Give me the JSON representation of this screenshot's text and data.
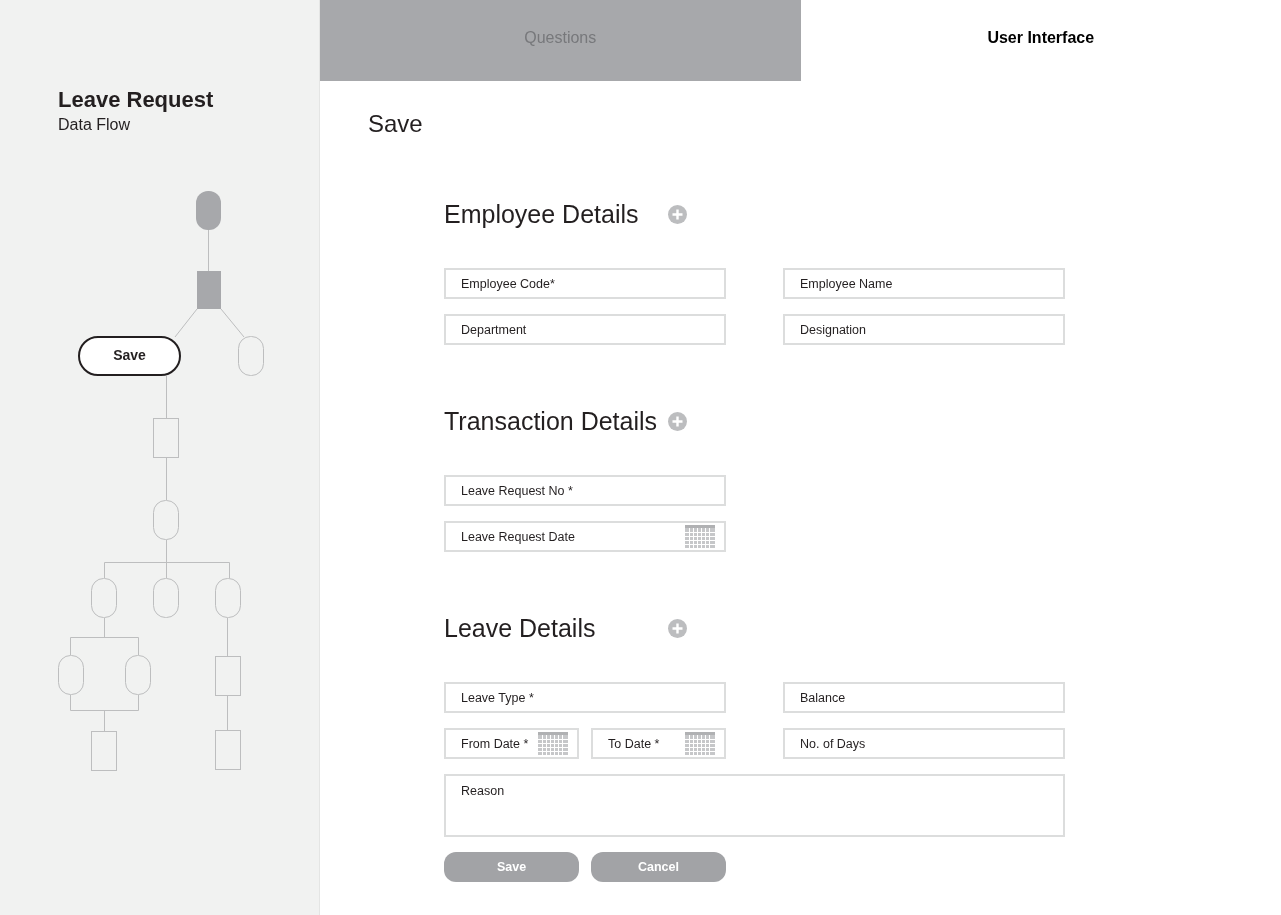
{
  "sidebar": {
    "title": "Leave Request",
    "subtitle": "Data Flow",
    "flow_node_label": "Save"
  },
  "tabs": [
    {
      "label": "Questions",
      "selected": false
    },
    {
      "label": "User Interface",
      "selected": true
    }
  ],
  "page_title": "Save",
  "sections": [
    {
      "title": "Employee Details",
      "rows": [
        {
          "left": [
            {
              "kind": "text",
              "placeholder": "Employee Code*"
            }
          ],
          "right": [
            {
              "kind": "text",
              "placeholder": "Employee Name"
            }
          ]
        },
        {
          "left": [
            {
              "kind": "text",
              "placeholder": "Department"
            }
          ],
          "right": [
            {
              "kind": "text",
              "placeholder": "Designation"
            }
          ]
        }
      ]
    },
    {
      "title": "Transaction Details",
      "rows": [
        {
          "left": [
            {
              "kind": "text",
              "placeholder": "Leave Request No *"
            }
          ]
        },
        {
          "left": [
            {
              "kind": "date",
              "placeholder": "Leave Request Date"
            }
          ]
        }
      ]
    },
    {
      "title": "Leave Details",
      "rows": [
        {
          "left": [
            {
              "kind": "text",
              "placeholder": "Leave Type *"
            }
          ],
          "right": [
            {
              "kind": "text",
              "placeholder": "Balance"
            }
          ]
        },
        {
          "left": [
            {
              "kind": "date",
              "placeholder": "From Date *"
            },
            {
              "kind": "date",
              "placeholder": "To Date *"
            }
          ],
          "right": [
            {
              "kind": "text",
              "placeholder": "No. of Days"
            }
          ]
        },
        {
          "full": [
            {
              "kind": "textarea",
              "placeholder": "Reason"
            }
          ]
        }
      ]
    }
  ],
  "buttons": [
    {
      "label": "Save",
      "disabled": true
    },
    {
      "label": "Cancel",
      "disabled": true
    }
  ]
}
